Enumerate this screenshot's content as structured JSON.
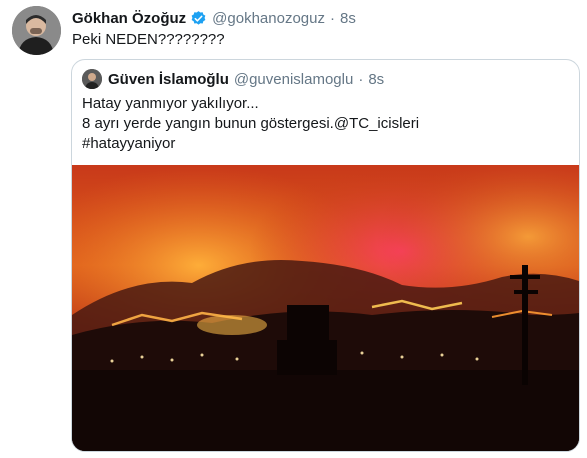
{
  "tweet": {
    "author_name": "Gökhan Özoğuz",
    "handle": "@gokhanozoguz",
    "separator": "·",
    "time": "8s",
    "text": "Peki NEDEN????????",
    "icons": {
      "avatar": "user-avatar",
      "verified": "verified-badge-icon"
    },
    "colors": {
      "verified": "#1da1f2",
      "secondary_text": "#657786",
      "border": "#ccd6dd"
    }
  },
  "quoted_tweet": {
    "author_name": "Güven İslamoğlu",
    "handle": "@guvenislamoglu",
    "separator": "·",
    "time": "8s",
    "text_lines": [
      "Hatay yanmıyor yakılıyor...",
      "8 ayrı yerde yangın bunun göstergesi.",
      "#hatayyaniyor"
    ],
    "mention": "@TC_icisleri",
    "media": {
      "type": "photo",
      "subject": "forest-fire-night-photo"
    }
  }
}
